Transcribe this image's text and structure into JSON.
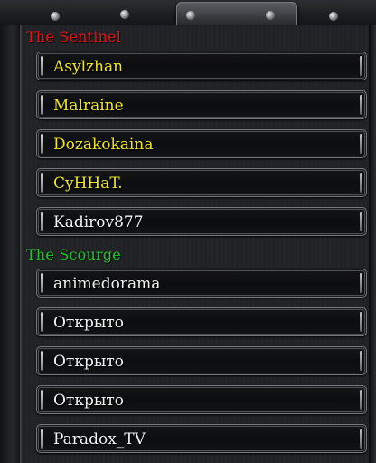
{
  "teams": {
    "sentinel": {
      "label": "The Sentinel",
      "color": "#e01616",
      "slots": [
        "Asylzhan",
        "Malraine",
        "Dozakokaina",
        "CyHHaT.",
        "Kadirov877"
      ]
    },
    "scourge": {
      "label": "The Scourge",
      "color": "#22c52c",
      "slots": [
        "animedorama",
        "Открыто",
        "Открыто",
        "Открыто",
        "Paradox_TV"
      ]
    }
  }
}
